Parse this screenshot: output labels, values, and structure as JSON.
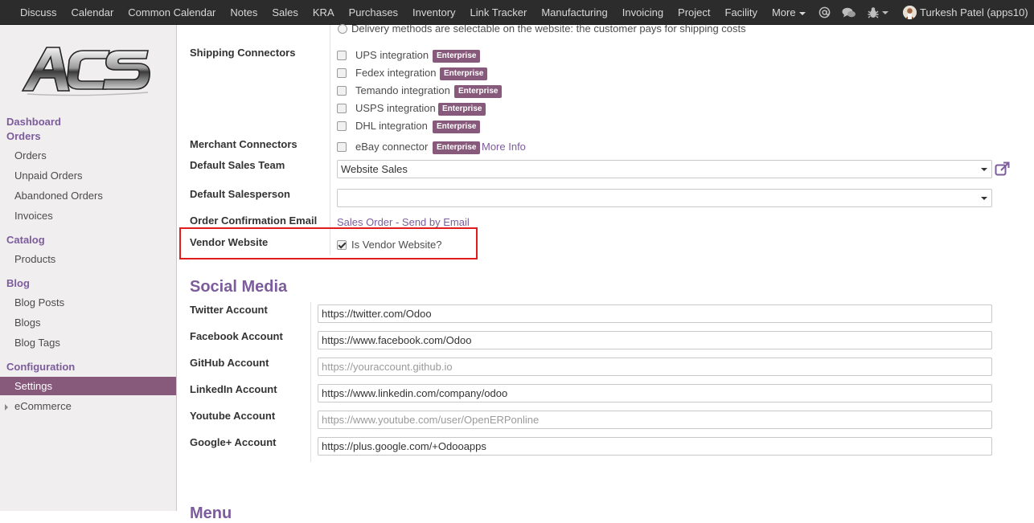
{
  "topbar": {
    "menu": [
      "Discuss",
      "Calendar",
      "Common Calendar",
      "Notes",
      "Sales",
      "KRA",
      "Purchases",
      "Inventory",
      "Link Tracker",
      "Manufacturing",
      "Invoicing",
      "Project",
      "Facility"
    ],
    "more_label": "More",
    "user_name": "Turkesh Patel (apps10)"
  },
  "sidebar": {
    "dashboard": "Dashboard",
    "orders_header": "Orders",
    "orders_items": [
      "Orders",
      "Unpaid Orders",
      "Abandoned Orders",
      "Invoices"
    ],
    "catalog_header": "Catalog",
    "catalog_items": [
      "Products"
    ],
    "blog_header": "Blog",
    "blog_items": [
      "Blog Posts",
      "Blogs",
      "Blog Tags"
    ],
    "config_header": "Configuration",
    "config_active": "Settings",
    "ecommerce": "eCommerce"
  },
  "settings": {
    "delivery_radio": "Delivery methods are selectable on the website: the customer pays for shipping costs",
    "shipping_label": "Shipping Connectors",
    "shipping": [
      {
        "label": "UPS integration",
        "badge": "Enterprise"
      },
      {
        "label": "Fedex integration",
        "badge": "Enterprise"
      },
      {
        "label": "Temando integration",
        "badge": "Enterprise"
      },
      {
        "label": "USPS integration",
        "badge": "Enterprise"
      },
      {
        "label": "DHL integration",
        "badge": "Enterprise"
      }
    ],
    "merchant_label": "Merchant Connectors",
    "ebay_label": "eBay connector",
    "ebay_badge": "Enterprise",
    "more_info": "More Info",
    "sales_team_label": "Default Sales Team",
    "sales_team_value": "Website Sales",
    "salesperson_label": "Default Salesperson",
    "salesperson_value": "",
    "confirm_label": "Order Confirmation Email",
    "confirm_link": "Sales Order - Send by Email",
    "vendor_label": "Vendor Website",
    "vendor_checkbox": "Is Vendor Website?",
    "vendor_checked": true
  },
  "social": {
    "title": "Social Media",
    "accounts": [
      {
        "label": "Twitter Account",
        "value": "https://twitter.com/Odoo",
        "placeholder": ""
      },
      {
        "label": "Facebook Account",
        "value": "https://www.facebook.com/Odoo",
        "placeholder": ""
      },
      {
        "label": "GitHub Account",
        "value": "",
        "placeholder": "https://youraccount.github.io"
      },
      {
        "label": "LinkedIn Account",
        "value": "https://www.linkedin.com/company/odoo",
        "placeholder": ""
      },
      {
        "label": "Youtube Account",
        "value": "",
        "placeholder": "https://www.youtube.com/user/OpenERPonline"
      },
      {
        "label": "Google+ Account",
        "value": "https://plus.google.com/+Odooapps",
        "placeholder": ""
      }
    ]
  },
  "next_section": "Menu",
  "colors": {
    "topbar": "#2c2c2c",
    "accent": "#875a7b",
    "highlight": "#e01c1c"
  },
  "icons": [
    "at-icon",
    "chat-icon",
    "bug-icon",
    "external-link-icon",
    "acs-logo"
  ]
}
